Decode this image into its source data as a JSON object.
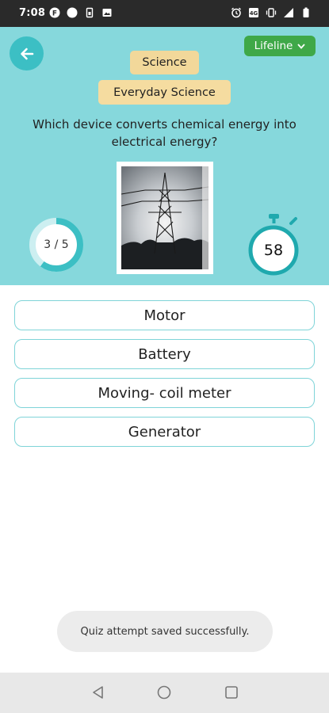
{
  "status_bar": {
    "time": "7:08",
    "left_icons": [
      "f-icon",
      "circle-icon",
      "sim-icon",
      "image-icon"
    ],
    "right_icons": [
      "alarm-icon",
      "data-icon",
      "vibrate-icon",
      "signal-icon",
      "battery-icon"
    ]
  },
  "header": {
    "background": "#86d8dc",
    "back_icon": "arrow-left-icon",
    "lifeline_label": "Lifeline",
    "subject": "Science",
    "topic": "Everyday Science",
    "question": "Which device converts chemical energy into electrical energy?",
    "image_icon": "transmission-tower-photo"
  },
  "progress": {
    "label": "3 / 5",
    "current": 3,
    "total": 5,
    "ring_color": "#3cbfc4"
  },
  "timer": {
    "seconds": "58",
    "icon": "stopwatch-icon",
    "ring_color": "#1fa9ae"
  },
  "options": [
    {
      "label": "Motor"
    },
    {
      "label": "Battery"
    },
    {
      "label": "Moving- coil meter"
    },
    {
      "label": "Generator"
    }
  ],
  "toast": {
    "message": "Quiz attempt saved successfully."
  },
  "nav_bar": {
    "icons": [
      "nav-back-icon",
      "nav-home-icon",
      "nav-recents-icon"
    ]
  },
  "colors": {
    "accent": "#3cbfc4",
    "lifeline": "#3fa848",
    "chip": "#f5dca0",
    "option_border": "#7fd4d8"
  }
}
